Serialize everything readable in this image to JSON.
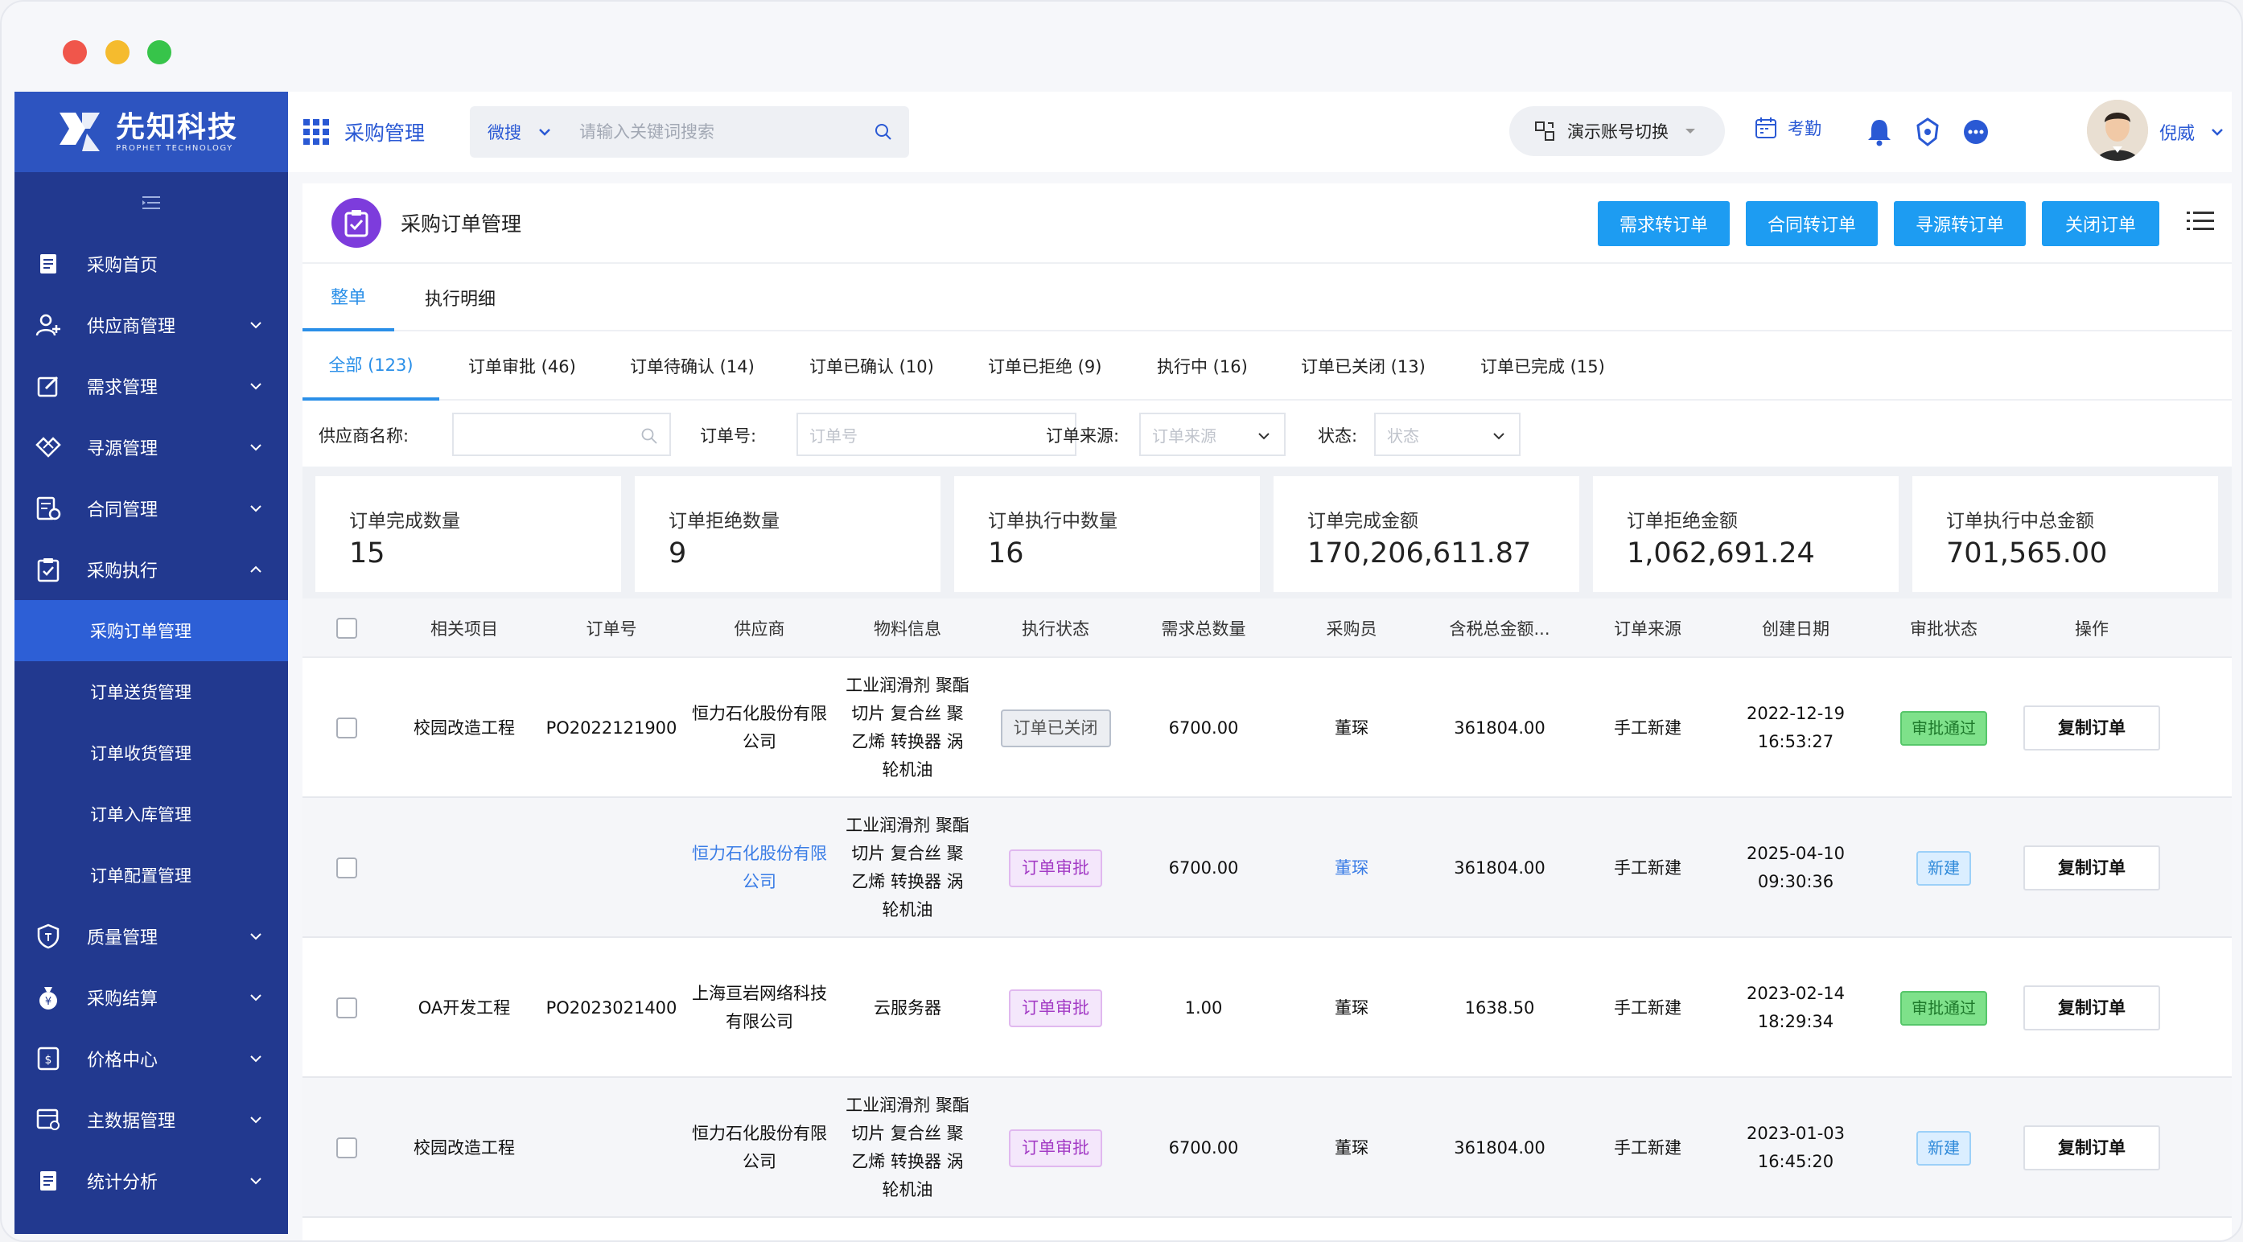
{
  "brand": {
    "name_cn": "先知科技",
    "name_en": "PROPHET TECHNOLOGY"
  },
  "sidebar": {
    "items": [
      {
        "label": "采购首页",
        "icon": "home-doc-icon",
        "expandable": false
      },
      {
        "label": "供应商管理",
        "icon": "user-add-icon",
        "expandable": true
      },
      {
        "label": "需求管理",
        "icon": "edit-icon",
        "expandable": true
      },
      {
        "label": "寻源管理",
        "icon": "handshake-icon",
        "expandable": true
      },
      {
        "label": "合同管理",
        "icon": "contract-icon",
        "expandable": true
      },
      {
        "label": "采购执行",
        "icon": "clipboard-check-icon",
        "expandable": true,
        "expanded": true
      },
      {
        "label": "质量管理",
        "icon": "shield-icon",
        "expandable": true
      },
      {
        "label": "采购结算",
        "icon": "moneybag-icon",
        "expandable": true
      },
      {
        "label": "价格中心",
        "icon": "price-icon",
        "expandable": true
      },
      {
        "label": "主数据管理",
        "icon": "database-icon",
        "expandable": true
      },
      {
        "label": "统计分析",
        "icon": "report-icon",
        "expandable": true
      }
    ],
    "sub_items": [
      {
        "label": "采购订单管理",
        "active": true
      },
      {
        "label": "订单送货管理"
      },
      {
        "label": "订单收货管理"
      },
      {
        "label": "订单入库管理"
      },
      {
        "label": "订单配置管理"
      }
    ]
  },
  "topbar": {
    "module_title": "采购管理",
    "search_scope": "微搜",
    "search_placeholder": "请输入关键词搜索",
    "account_switch": "演示账号切换",
    "attendance": "考勤",
    "username": "倪威"
  },
  "page": {
    "title": "采购订单管理",
    "actions": [
      "需求转订单",
      "合同转订单",
      "寻源转订单",
      "关闭订单"
    ],
    "view_tabs": [
      {
        "label": "整单",
        "active": true
      },
      {
        "label": "执行明细"
      }
    ],
    "status_tabs": [
      {
        "label": "全部 (123)",
        "active": true
      },
      {
        "label": "订单审批 (46)"
      },
      {
        "label": "订单待确认 (14)"
      },
      {
        "label": "订单已确认 (10)"
      },
      {
        "label": "订单已拒绝 (9)"
      },
      {
        "label": "执行中 (16)"
      },
      {
        "label": "订单已关闭 (13)"
      },
      {
        "label": "订单已完成 (15)"
      }
    ],
    "filters": {
      "supplier_label": "供应商名称:",
      "order_no_label": "订单号:",
      "order_no_placeholder": "订单号",
      "source_label": "订单来源:",
      "source_placeholder": "订单来源",
      "status_label": "状态:",
      "status_placeholder": "状态"
    },
    "stats": [
      {
        "label": "订单完成数量",
        "value": "15"
      },
      {
        "label": "订单拒绝数量",
        "value": "9"
      },
      {
        "label": "订单执行中数量",
        "value": "16"
      },
      {
        "label": "订单完成金额",
        "value": "170,206,611.87"
      },
      {
        "label": "订单拒绝金额",
        "value": "1,062,691.24"
      },
      {
        "label": "订单执行中总金额",
        "value": "701,565.00"
      }
    ]
  },
  "table": {
    "columns": [
      "相关项目",
      "订单号",
      "供应商",
      "物料信息",
      "执行状态",
      "需求总数量",
      "采购员",
      "含税总金额...",
      "订单来源",
      "创建日期",
      "审批状态",
      "操作"
    ],
    "rows": [
      {
        "project": "校园改造工程",
        "order_no": "PO2022121900",
        "supplier": "恒力石化股份有限公司",
        "supplier_link": false,
        "material": "工业润滑剂 聚酯切片 复合丝 聚乙烯 转换器 涡轮机油",
        "exec_status": "订单已关闭",
        "exec_style": "gray",
        "quantity": "6700.00",
        "buyer": "董琛",
        "buyer_link": false,
        "amount": "361804.00",
        "source": "手工新建",
        "date": "2022-12-19",
        "time": "16:53:27",
        "approval": "审批通过",
        "approval_style": "green",
        "action": "复制订单"
      },
      {
        "project": "",
        "order_no": "",
        "supplier": "恒力石化股份有限公司",
        "supplier_link": true,
        "material": "工业润滑剂 聚酯切片 复合丝 聚乙烯 转换器 涡轮机油",
        "exec_status": "订单审批",
        "exec_style": "purple",
        "quantity": "6700.00",
        "buyer": "董琛",
        "buyer_link": true,
        "amount": "361804.00",
        "source": "手工新建",
        "date": "2025-04-10",
        "time": "09:30:36",
        "approval": "新建",
        "approval_style": "blue",
        "action": "复制订单"
      },
      {
        "project": "OA开发工程",
        "order_no": "PO2023021400",
        "supplier": "上海亘岩网络科技有限公司",
        "supplier_link": false,
        "material": "云服务器",
        "exec_status": "订单审批",
        "exec_style": "purple",
        "quantity": "1.00",
        "buyer": "董琛",
        "buyer_link": false,
        "amount": "1638.50",
        "source": "手工新建",
        "date": "2023-02-14",
        "time": "18:29:34",
        "approval": "审批通过",
        "approval_style": "green",
        "action": "复制订单"
      },
      {
        "project": "校园改造工程",
        "order_no": "",
        "supplier": "恒力石化股份有限公司",
        "supplier_link": false,
        "material": "工业润滑剂 聚酯切片 复合丝 聚乙烯 转换器 涡轮机油",
        "exec_status": "订单审批",
        "exec_style": "purple",
        "quantity": "6700.00",
        "buyer": "董琛",
        "buyer_link": false,
        "amount": "361804.00",
        "source": "手工新建",
        "date": "2023-01-03",
        "time": "16:45:20",
        "approval": "新建",
        "approval_style": "blue",
        "action": "复制订单"
      }
    ]
  },
  "colors": {
    "sidebar_bg": "#22398f",
    "sidebar_active": "#2d5fd6",
    "primary_button": "#1d9cf2",
    "link": "#2a8fe8",
    "page_icon": "#7d3cdc"
  }
}
